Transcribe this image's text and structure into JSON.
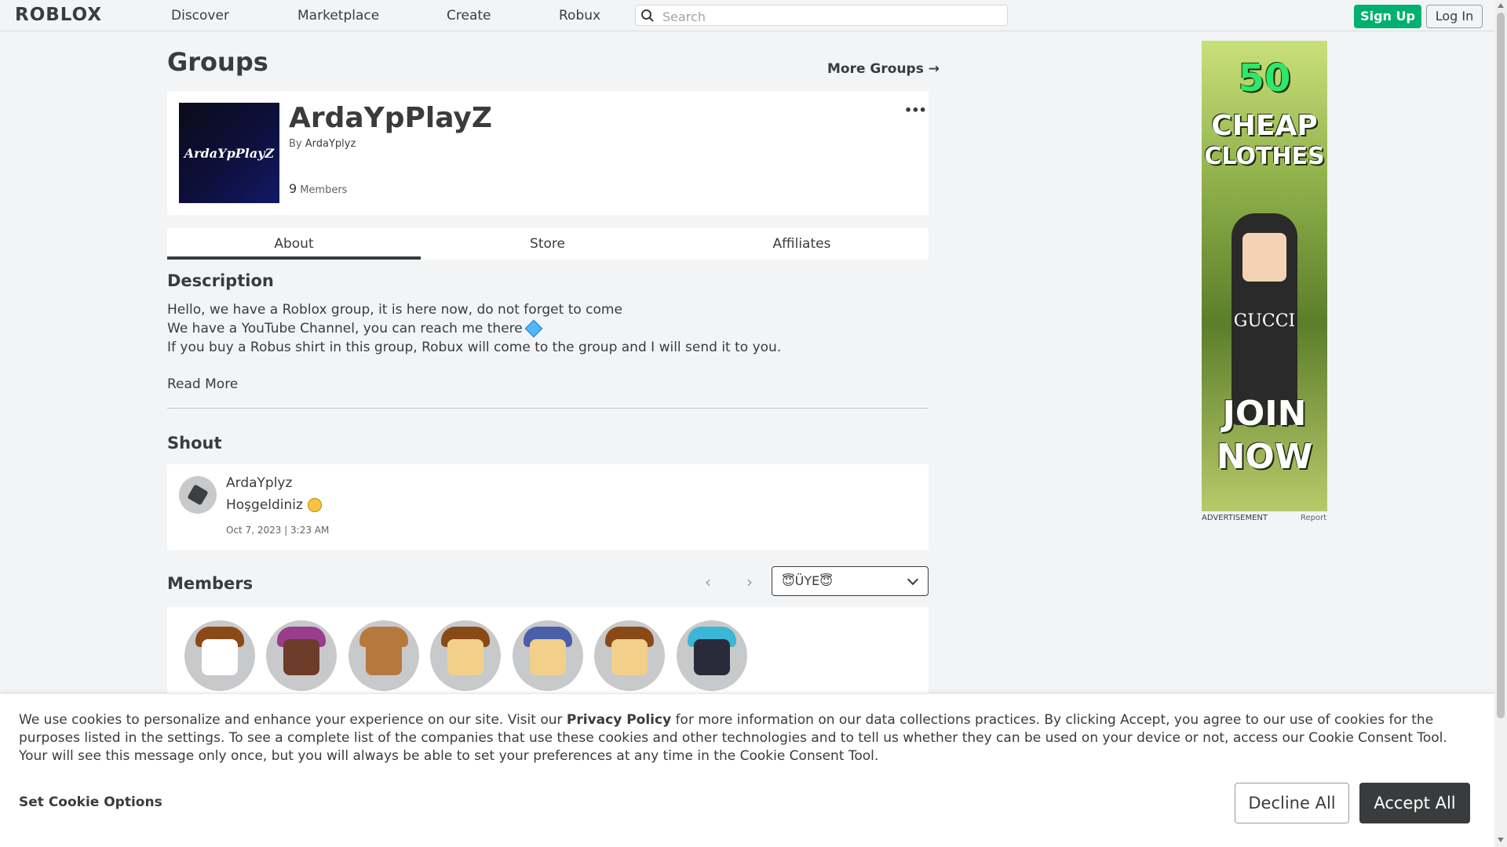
{
  "nav": {
    "logo": "ROBLOX",
    "links": [
      "Discover",
      "Marketplace",
      "Create",
      "Robux"
    ],
    "search_placeholder": "Search",
    "signup": "Sign Up",
    "login": "Log In"
  },
  "page": {
    "title": "Groups",
    "more_groups": "More Groups →"
  },
  "group": {
    "emblem_text": "ArdaYpPlayZ",
    "name": "ArdaYpPlayZ",
    "by_label": "By",
    "owner": "ArdaYplyz",
    "member_count": "9",
    "member_label": "Members",
    "menu": "•••"
  },
  "tabs": [
    {
      "label": "About",
      "active": true
    },
    {
      "label": "Store",
      "active": false
    },
    {
      "label": "Affiliates",
      "active": false
    }
  ],
  "description": {
    "title": "Description",
    "lines": [
      "Hello, we have a Roblox group, it is here now, do not forget to come",
      "We have a YouTube Channel, you can reach me there",
      "If you buy a Robus shirt in this group, Robux will come to the group and I will send it to you."
    ],
    "read_more": "Read More"
  },
  "shout": {
    "title": "Shout",
    "user": "ArdaYplyz",
    "text": "Hoşgeldiniz",
    "date": "Oct 7, 2023 | 3:23 AM"
  },
  "members": {
    "title": "Members",
    "role": "😇ÜYE😇",
    "prev": "‹",
    "next": "›",
    "avatars": [
      {
        "skin": "#ffffff",
        "hair": "#8a4a18"
      },
      {
        "skin": "#6d3b2a",
        "hair": "#9a3c8c"
      },
      {
        "skin": "#b5793e",
        "hair": "#b5793e"
      },
      {
        "skin": "#f3d08a",
        "hair": "#8a4a18"
      },
      {
        "skin": "#f3d08a",
        "hair": "#4a5fa8"
      },
      {
        "skin": "#f3d08a",
        "hair": "#8a4a18"
      },
      {
        "skin": "#2a2a3a",
        "hair": "#3bb6d6"
      }
    ]
  },
  "ad": {
    "line1": "50",
    "line2": "CHEAP",
    "line3": "CLOTHES",
    "brand": "GUCCI",
    "line4": "JOIN",
    "line5": "NOW",
    "label": "ADVERTISEMENT",
    "report": "Report"
  },
  "cookie": {
    "text_before": "We use cookies to personalize and enhance your experience on our site. Visit our ",
    "privacy_link": "Privacy Policy",
    "text_after": " for more information on our data collections practices. By clicking Accept, you agree to our use of cookies for the purposes listed in the settings. To see a complete list of the companies that use these cookies and other technologies and to tell us whether they can be used on your device or not, access our Cookie Consent Tool. Your will see this message only once, but you will always be able to set your preferences at any time in the Cookie Consent Tool.",
    "options": "Set Cookie Options",
    "decline": "Decline All",
    "accept": "Accept All"
  }
}
